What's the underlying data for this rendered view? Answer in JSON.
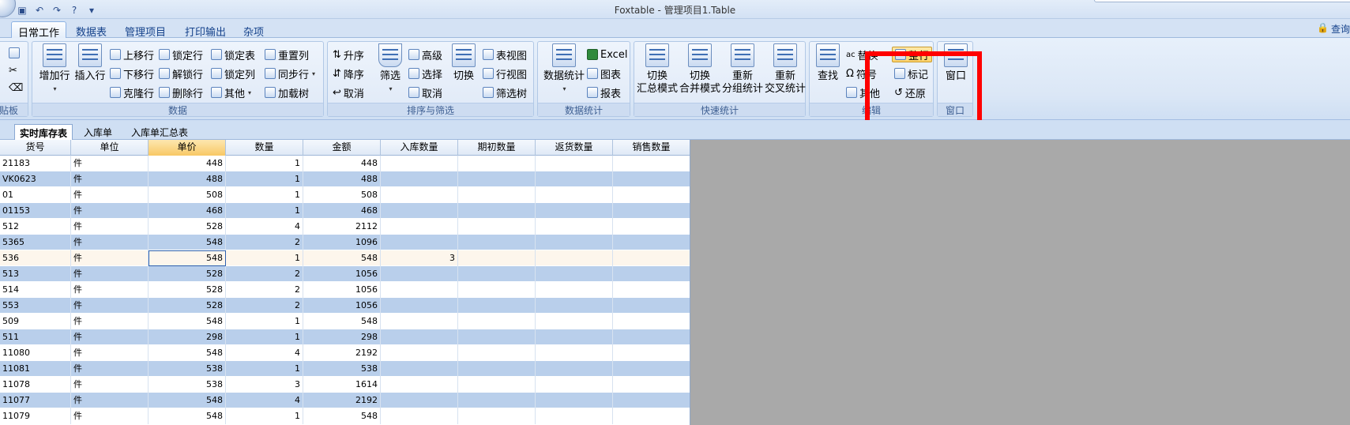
{
  "titlebar": {
    "title": "Foxtable - 管理项目1.Table",
    "qat": [
      {
        "icon": "save-icon",
        "glyph": "▣"
      },
      {
        "icon": "undo-icon",
        "glyph": "↶"
      },
      {
        "icon": "redo-icon",
        "glyph": "↷"
      },
      {
        "icon": "help-icon",
        "glyph": "?"
      },
      {
        "icon": "customize-icon",
        "glyph": "▾"
      }
    ]
  },
  "ribbon_tabs": [
    "日常工作",
    "数据表",
    "管理项目",
    "打印输出",
    "杂项"
  ],
  "active_tab": "日常工作",
  "login_label": "查询",
  "groups": {
    "clipboard": {
      "label": "贴板"
    },
    "data": {
      "label": "数据",
      "add_row": "增加行",
      "insert_row": "插入行",
      "move_up": "上移行",
      "move_down": "下移行",
      "clone_row": "克隆行",
      "lock_row": "锁定行",
      "unlock_row": "解锁行",
      "delete_row": "删除行",
      "lock_table": "锁定表",
      "lock_column": "锁定列",
      "other": "其他",
      "reset_column": "重置列",
      "sync_row": "同步行",
      "load_tree": "加载树"
    },
    "sort": {
      "label": "排序与筛选",
      "asc": "升序",
      "desc": "降序",
      "cancel_sort": "取消",
      "filter": "筛选",
      "advanced": "高级",
      "select": "选择",
      "cancel_filter": "取消",
      "toggle": "切换",
      "table_view": "表视图",
      "row_view": "行视图",
      "filter_tree": "筛选树"
    },
    "stats": {
      "label": "数据统计",
      "data_stats": "数据统计",
      "excel": "Excel",
      "chart": "图表",
      "report": "报表"
    },
    "quick": {
      "label": "快速统计",
      "switch_summary": [
        "切换",
        "汇总模式"
      ],
      "switch_merge": [
        "切换",
        "合并模式"
      ],
      "regroup": [
        "重新",
        "分组统计"
      ],
      "recross": [
        "重新",
        "交叉统计"
      ]
    },
    "edit": {
      "label": "编辑",
      "find": "查找",
      "replace": "替换",
      "symbol": "符号",
      "other": "其他",
      "whole_row": "整行",
      "mark": "标记",
      "restore": "还原"
    },
    "window": {
      "label": "窗口",
      "window_btn": "窗口"
    }
  },
  "sheet_tabs": [
    "实时库存表",
    "入库单",
    "入库单汇总表"
  ],
  "active_sheet": "实时库存表",
  "table": {
    "columns": [
      "货号",
      "单位",
      "单价",
      "数量",
      "金额",
      "入库数量",
      "期初数量",
      "返货数量",
      "销售数量"
    ],
    "selected_column": "单价",
    "current_row_index": 6,
    "rows": [
      [
        "21183",
        "件",
        "448",
        "1",
        "448",
        "",
        "",
        "",
        ""
      ],
      [
        "VK0623",
        "件",
        "488",
        "1",
        "488",
        "",
        "",
        "",
        ""
      ],
      [
        "01",
        "件",
        "508",
        "1",
        "508",
        "",
        "",
        "",
        ""
      ],
      [
        "01153",
        "件",
        "468",
        "1",
        "468",
        "",
        "",
        "",
        ""
      ],
      [
        "512",
        "件",
        "528",
        "4",
        "2112",
        "",
        "",
        "",
        ""
      ],
      [
        "5365",
        "件",
        "548",
        "2",
        "1096",
        "",
        "",
        "",
        ""
      ],
      [
        "536",
        "件",
        "548",
        "1",
        "548",
        "3",
        "",
        "",
        ""
      ],
      [
        "513",
        "件",
        "528",
        "2",
        "1056",
        "",
        "",
        "",
        ""
      ],
      [
        "514",
        "件",
        "528",
        "2",
        "1056",
        "",
        "",
        "",
        ""
      ],
      [
        "553",
        "件",
        "528",
        "2",
        "1056",
        "",
        "",
        "",
        ""
      ],
      [
        "509",
        "件",
        "548",
        "1",
        "548",
        "",
        "",
        "",
        ""
      ],
      [
        "511",
        "件",
        "298",
        "1",
        "298",
        "",
        "",
        "",
        ""
      ],
      [
        "11080",
        "件",
        "548",
        "4",
        "2192",
        "",
        "",
        "",
        ""
      ],
      [
        "11081",
        "件",
        "538",
        "1",
        "538",
        "",
        "",
        "",
        ""
      ],
      [
        "11078",
        "件",
        "538",
        "3",
        "1614",
        "",
        "",
        "",
        ""
      ],
      [
        "11077",
        "件",
        "548",
        "4",
        "2192",
        "",
        "",
        "",
        ""
      ],
      [
        "11079",
        "件",
        "548",
        "1",
        "548",
        "",
        "",
        "",
        ""
      ]
    ]
  },
  "colors": {
    "highlight_box": "#ff0000",
    "row_alt": "#b9cfeb",
    "selected_header": "#f8c865"
  }
}
